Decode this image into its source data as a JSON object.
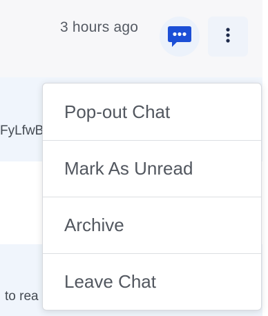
{
  "conversation": {
    "timestamp": "3 hours ago",
    "snippet_a": "FyLfwB",
    "snippet_c": "to rea"
  },
  "icons": {
    "chat": "chat-bubble-dots-icon",
    "more": "kebab-vertical-icon"
  },
  "colors": {
    "accent": "#1c4fd6",
    "dark_navy": "#1e2a4a"
  },
  "menu": {
    "items": [
      {
        "label": "Pop-out Chat"
      },
      {
        "label": "Mark As Unread"
      },
      {
        "label": "Archive"
      },
      {
        "label": "Leave Chat"
      }
    ]
  }
}
